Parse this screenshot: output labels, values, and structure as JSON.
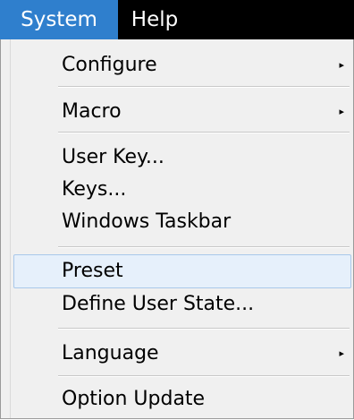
{
  "menubar": {
    "system_label": "System",
    "help_label": "Help"
  },
  "system_menu": {
    "items": [
      {
        "label": "Configure",
        "has_submenu": true,
        "arrow": "▸"
      },
      {
        "label": "Macro",
        "has_submenu": true,
        "arrow": "▸"
      },
      {
        "label": "User Key...",
        "has_submenu": false
      },
      {
        "label": "Keys...",
        "has_submenu": false
      },
      {
        "label": "Windows Taskbar",
        "has_submenu": false
      },
      {
        "label": "Preset",
        "has_submenu": false,
        "highlighted": true
      },
      {
        "label": "Define User State...",
        "has_submenu": false
      },
      {
        "label": "Language",
        "has_submenu": true,
        "arrow": "▸"
      },
      {
        "label": "Option Update",
        "has_submenu": false
      }
    ]
  },
  "colors": {
    "selected_menubar_bg": "#2f7fcd",
    "highlight_bg": "#e6f0fb",
    "highlight_border": "#a9c8ea"
  }
}
